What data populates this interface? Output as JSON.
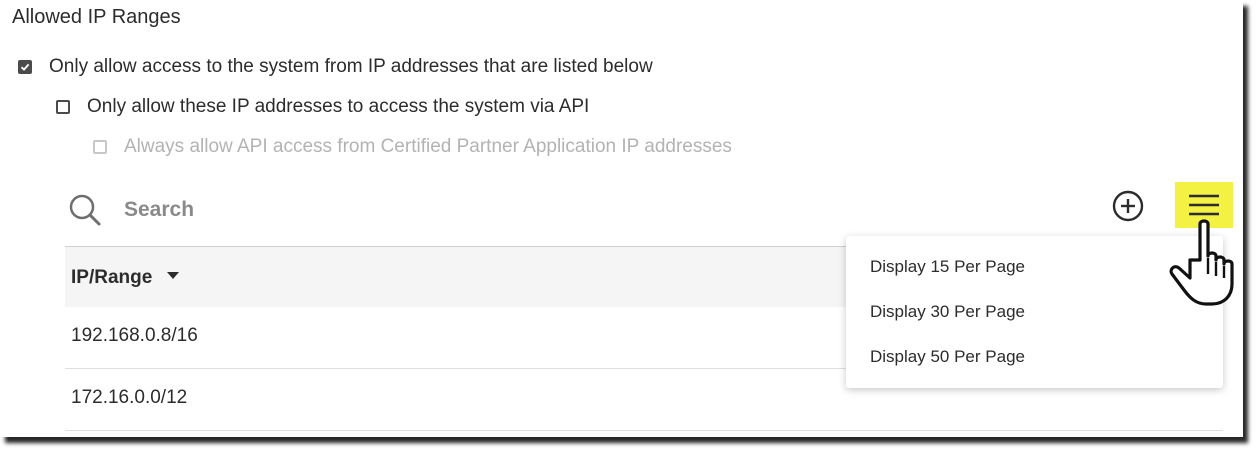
{
  "section": {
    "title": "Allowed IP Ranges"
  },
  "options": {
    "only_listed": {
      "label": "Only allow access to the system from IP addresses that are listed below",
      "checked": true,
      "disabled": false
    },
    "api_only": {
      "label": "Only allow these IP addresses to access the system via API",
      "checked": false,
      "disabled": false
    },
    "certified_partner": {
      "label": "Always allow API access from Certified Partner Application IP addresses",
      "checked": false,
      "disabled": true
    }
  },
  "search": {
    "placeholder": "Search",
    "value": ""
  },
  "toolbar": {
    "add_icon": "plus-circle-icon",
    "menu_icon": "hamburger-menu-icon",
    "menu_highlight_color": "#f3f142"
  },
  "table": {
    "columns": [
      {
        "label": "IP/Range",
        "sort": "descending"
      }
    ],
    "rows": [
      {
        "ip_range": "192.168.0.8/16"
      },
      {
        "ip_range": "172.16.0.0/12"
      }
    ]
  },
  "dropdown": {
    "items": [
      {
        "label": "Display 15 Per Page"
      },
      {
        "label": "Display 30 Per Page"
      },
      {
        "label": "Display 50 Per Page"
      }
    ]
  },
  "colors": {
    "text": "#2c2c2c",
    "disabled_text": "#b3b3b3",
    "header_bg": "#f5f5f5"
  }
}
